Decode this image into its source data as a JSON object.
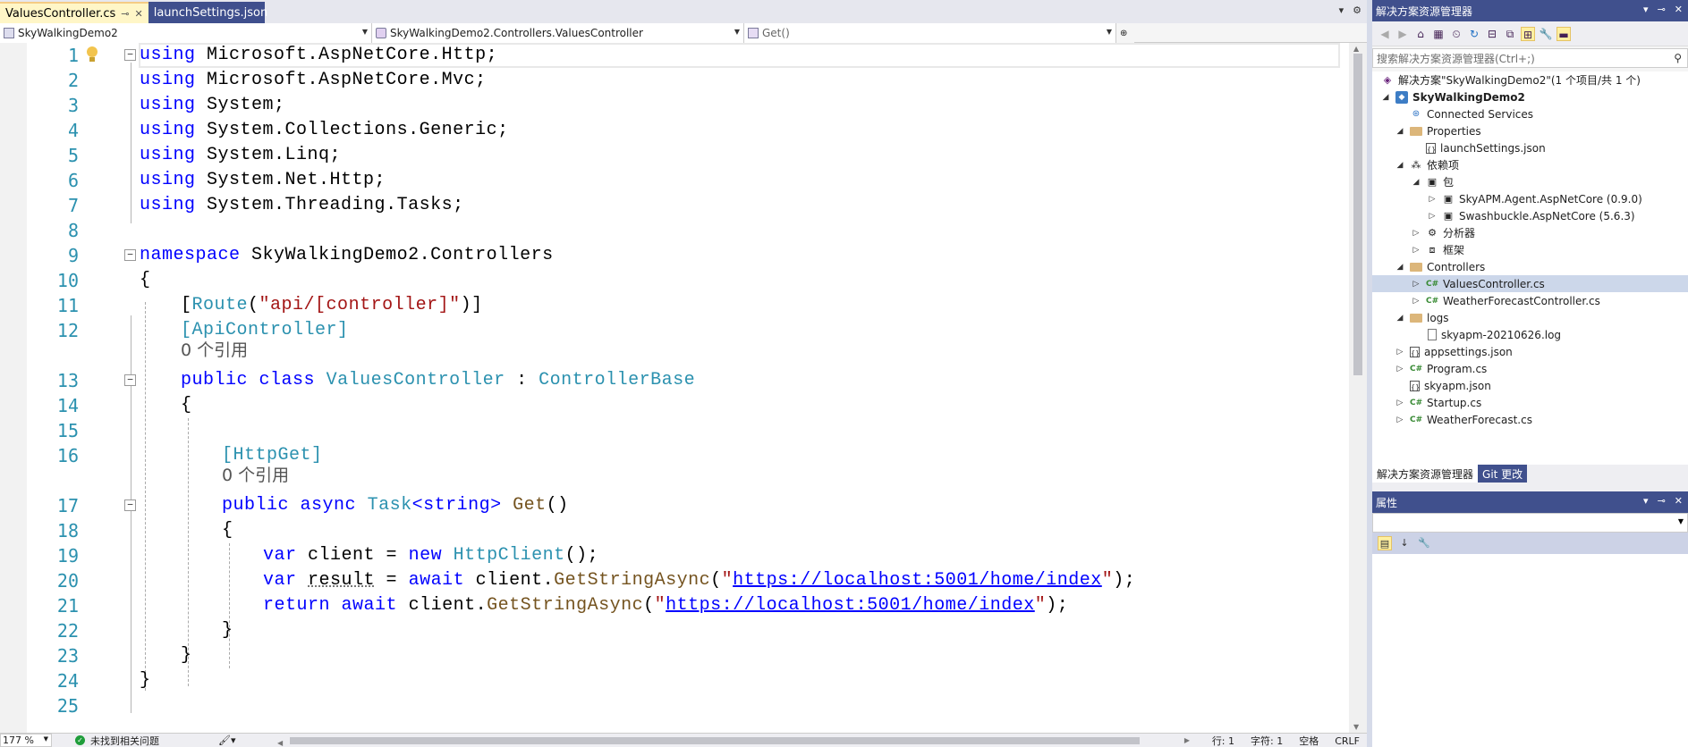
{
  "tabs": [
    {
      "label": "ValuesController.cs",
      "active": true
    },
    {
      "label": "launchSettings.json",
      "active": false
    }
  ],
  "navbar": {
    "project": "SkyWalkingDemo2",
    "class": "SkyWalkingDemo2.Controllers.ValuesController",
    "member": "Get()"
  },
  "code": {
    "line_numbers": [
      "1",
      "2",
      "3",
      "4",
      "5",
      "6",
      "7",
      "8",
      "9",
      "10",
      "11",
      "12",
      "13",
      "14",
      "15",
      "16",
      "17",
      "18",
      "19",
      "20",
      "21",
      "22",
      "23",
      "24",
      "25"
    ],
    "usings": [
      "Microsoft.AspNetCore.Http;",
      "Microsoft.AspNetCore.Mvc;",
      "System;",
      "System.Collections.Generic;",
      "System.Linq;",
      "System.Net.Http;",
      "System.Threading.Tasks;"
    ],
    "kw_using": "using",
    "kw_namespace": "namespace",
    "namespace_name": "SkyWalkingDemo2.Controllers",
    "open_brace": "{",
    "close_brace": "}",
    "attr_route_open": "[",
    "attr_route_name": "Route",
    "attr_route_arg": "\"api/[controller]\"",
    "attr_route_close": ")]",
    "attr_apicontroller": "[ApiController]",
    "refs_label": "0 个引用",
    "kw_public": "public",
    "kw_class": "class",
    "class_name": "ValuesController",
    "colon": " : ",
    "base_class": "ControllerBase",
    "attr_httpget": "[HttpGet]",
    "kw_async": "async",
    "return_type": "Task",
    "type_param": "<string>",
    "method_name": "Get",
    "parens": "()",
    "kw_var": "var",
    "var_client": "client",
    "eq": " = ",
    "kw_new": "new",
    "httpclient": "HttpClient",
    "call_end": "();",
    "var_result": "result",
    "kw_await": "await",
    "client_dot": "client.",
    "get_string_async": "GetStringAsync",
    "url": "https://localhost:5001/home/index",
    "kw_return": "return"
  },
  "status": {
    "zoom": "177 %",
    "issues": "未找到相关问题",
    "line": "行: 1",
    "char": "字符: 1",
    "whitespace": "空格",
    "eol": "CRLF"
  },
  "solution_explorer": {
    "title": "解决方案资源管理器",
    "search_placeholder": "搜索解决方案资源管理器(Ctrl+;)",
    "nodes": [
      {
        "label": "解决方案\"SkyWalkingDemo2\"(1 个项目/共 1 个)",
        "icon": "solution-icon"
      },
      {
        "label": "SkyWalkingDemo2",
        "icon": "project-icon"
      },
      {
        "label": "Connected Services",
        "icon": "connected-services-icon"
      },
      {
        "label": "Properties",
        "icon": "properties-folder-icon"
      },
      {
        "label": "launchSettings.json",
        "icon": "json-file-icon"
      },
      {
        "label": "依赖项",
        "icon": "dependencies-icon"
      },
      {
        "label": "包",
        "icon": "package-icon"
      },
      {
        "label": "SkyAPM.Agent.AspNetCore (0.9.0)",
        "icon": "package-icon"
      },
      {
        "label": "Swashbuckle.AspNetCore (5.6.3)",
        "icon": "package-icon"
      },
      {
        "label": "分析器",
        "icon": "analyzer-icon"
      },
      {
        "label": "框架",
        "icon": "framework-icon"
      },
      {
        "label": "Controllers",
        "icon": "folder-icon"
      },
      {
        "label": "ValuesController.cs",
        "icon": "csharp-file-icon"
      },
      {
        "label": "WeatherForecastController.cs",
        "icon": "csharp-file-icon"
      },
      {
        "label": "logs",
        "icon": "folder-icon"
      },
      {
        "label": "skyapm-20210626.log",
        "icon": "file-icon"
      },
      {
        "label": "appsettings.json",
        "icon": "json-file-icon"
      },
      {
        "label": "Program.cs",
        "icon": "csharp-file-icon"
      },
      {
        "label": "skyapm.json",
        "icon": "json-file-icon"
      },
      {
        "label": "Startup.cs",
        "icon": "csharp-file-icon"
      },
      {
        "label": "WeatherForecast.cs",
        "icon": "csharp-file-icon"
      }
    ],
    "tabs": [
      "解决方案资源管理器",
      "Git 更改"
    ]
  },
  "properties": {
    "title": "属性"
  },
  "colors": {
    "keyword": "#0000ff",
    "type": "#2b91af",
    "string": "#a31515",
    "method": "#74531f",
    "panel_title": "#40508d",
    "active_tab": "#fff6c7"
  }
}
